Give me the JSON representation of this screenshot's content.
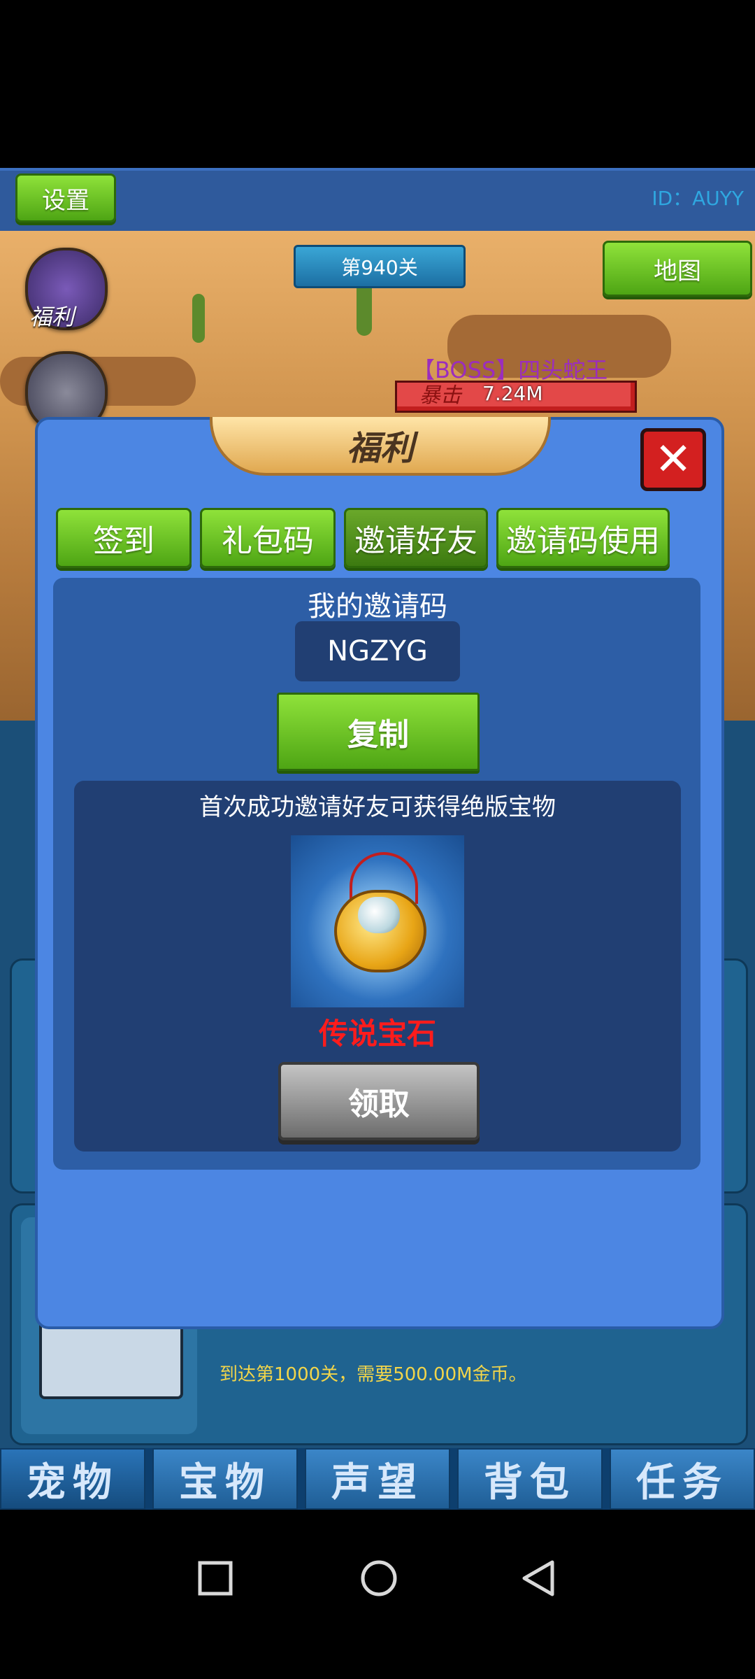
{
  "topbar": {
    "settings_label": "设置",
    "player_id": "ID：AUYY"
  },
  "scene": {
    "level_label": "第940关",
    "map_label": "地图",
    "welfare_icon_label": "福利",
    "boss_name": "【BOSS】四头蛇王",
    "crit_label": "暴击",
    "boss_hp": "7.24M"
  },
  "dialog": {
    "title": "福利",
    "close_glyph": "✕",
    "tabs": [
      "签到",
      "礼包码",
      "邀请好友",
      "邀请码使用"
    ],
    "active_tab": "邀请好友",
    "my_code_label": "我的邀请码",
    "invite_code": "NGZYG",
    "copy_label": "复制",
    "reward_description": "首次成功邀请好友可获得绝版宝物",
    "reward_name": "传说宝石",
    "claim_label": "领取"
  },
  "lower": {
    "level_requirement": "到达第1000关，需要500.00M金币。"
  },
  "bottom_tabs": [
    "宠物",
    "宝物",
    "声望",
    "背包",
    "任务"
  ],
  "colors": {
    "dialog_bg": "#4c86e3",
    "green_button": "#6cc225",
    "reward_name_red": "#ff1c1c",
    "claim_gray": "#8a8a8a"
  }
}
